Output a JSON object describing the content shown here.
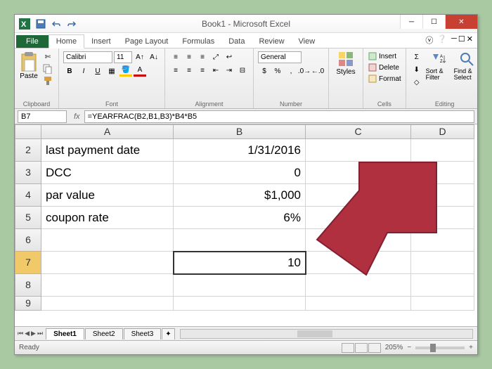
{
  "window": {
    "title": "Book1 - Microsoft Excel"
  },
  "tabs": {
    "file": "File",
    "home": "Home",
    "insert": "Insert",
    "pagelayout": "Page Layout",
    "formulas": "Formulas",
    "data": "Data",
    "review": "Review",
    "view": "View"
  },
  "ribbon": {
    "paste": "Paste",
    "clipboard_label": "Clipboard",
    "font_name": "Calibri",
    "font_size": "11",
    "font_label": "Font",
    "alignment_label": "Alignment",
    "number_format": "General",
    "number_label": "Number",
    "styles": "Styles",
    "insert": "Insert",
    "delete": "Delete",
    "format": "Format",
    "cells_label": "Cells",
    "sort_filter": "Sort & Filter",
    "find_select": "Find & Select",
    "editing_label": "Editing"
  },
  "formula_bar": {
    "cell_ref": "B7",
    "formula": "=YEARFRAC(B2,B1,B3)*B4*B5"
  },
  "col_headers": {
    "A": "A",
    "B": "B",
    "C": "C",
    "D": "D"
  },
  "row_headers": {
    "r2": "2",
    "r3": "3",
    "r4": "4",
    "r5": "5",
    "r6": "6",
    "r7": "7",
    "r8": "8",
    "r9": "9"
  },
  "cells": {
    "A2": "last payment date",
    "B2": "1/31/2016",
    "A3": "DCC",
    "B3": "0",
    "A4": "par value",
    "B4": "$1,000",
    "A5": "coupon rate",
    "B5": "6%",
    "B7": "10"
  },
  "sheets": {
    "s1": "Sheet1",
    "s2": "Sheet2",
    "s3": "Sheet3"
  },
  "status": {
    "ready": "Ready",
    "zoom": "205%"
  }
}
